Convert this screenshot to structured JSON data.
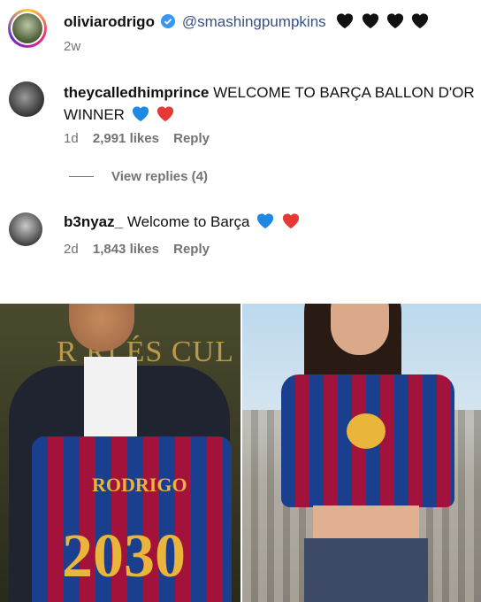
{
  "comments": [
    {
      "user": "oliviarodrigo",
      "mention": "@smashingpumpkins",
      "hearts": [
        "black",
        "black",
        "black",
        "black"
      ],
      "time": "2w"
    },
    {
      "user": "theycalledhimprince",
      "text_line1": "WELCOME TO BARÇA BALLON D'OR",
      "text_line2": "WINNER",
      "hearts": [
        "blue",
        "red"
      ],
      "time": "1d",
      "likes": "2,991 likes",
      "reply": "Reply",
      "view_replies": "View replies (4)"
    },
    {
      "user": "b3nyaz_",
      "text": "Welcome to Barça",
      "hearts": [
        "blue",
        "red"
      ],
      "time": "2d",
      "likes": "1,843 likes",
      "reply": "Reply"
    }
  ],
  "photos": {
    "left": {
      "backdrop_text": "R RI ÉS CUL",
      "shirt_name": "RODRIGO",
      "shirt_number": "2030"
    },
    "right": {}
  },
  "colors": {
    "verified": "#3897f0",
    "mention": "#385185",
    "meta": "#737373",
    "blue_heart": "#1e88e5",
    "red_heart": "#e53935",
    "black_heart": "#111111",
    "barca_blue": "#1b3f8f",
    "barca_red": "#a3123a",
    "gold": "#e9b53a"
  },
  "icons": [
    "verified-badge-icon",
    "heart-icon"
  ]
}
